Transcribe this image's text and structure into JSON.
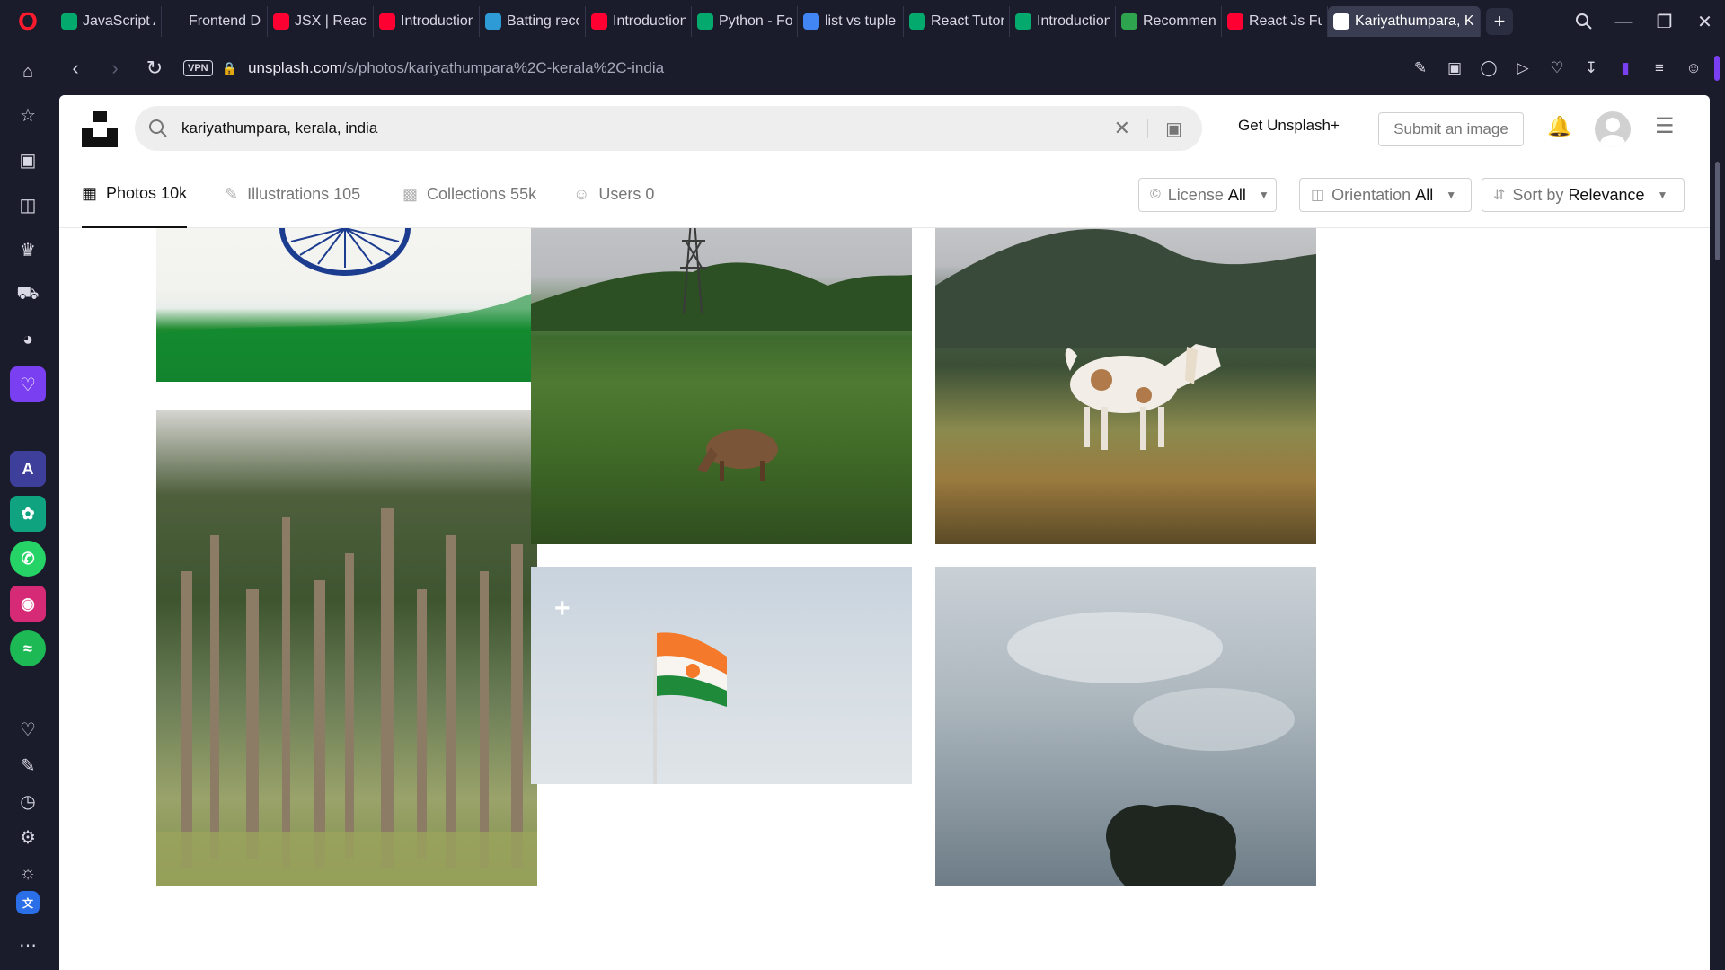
{
  "browser": {
    "tabs": [
      {
        "title": "JavaScript A",
        "favicon": "w3schools-icon",
        "color": "#04aa6d"
      },
      {
        "title": "Frontend De",
        "favicon": "freecodecamp-icon",
        "color": "#1b1c2b"
      },
      {
        "title": "JSX | React J",
        "favicon": "youtube-icon",
        "color": "#ff0033"
      },
      {
        "title": "Introduction",
        "favicon": "youtube-icon",
        "color": "#ff0033"
      },
      {
        "title": "Batting reco",
        "favicon": "globe-icon",
        "color": "#2e9bd6"
      },
      {
        "title": "Introduction",
        "favicon": "youtube-icon",
        "color": "#ff0033"
      },
      {
        "title": "Python - For",
        "favicon": "w3schools-icon",
        "color": "#04aa6d"
      },
      {
        "title": "list vs tuple",
        "favicon": "google-icon",
        "color": "#4285f4"
      },
      {
        "title": "React Tutori",
        "favicon": "w3schools-icon",
        "color": "#04aa6d"
      },
      {
        "title": "Introduction",
        "favicon": "w3schools-icon",
        "color": "#04aa6d"
      },
      {
        "title": "Recommenc",
        "favicon": "site-icon",
        "color": "#2ea44f"
      },
      {
        "title": "React Js Full",
        "favicon": "youtube-icon",
        "color": "#ff0033"
      },
      {
        "title": "Kariyathumpara, Kera",
        "favicon": "unsplash-icon",
        "color": "#ffffff"
      }
    ],
    "url_host": "unsplash.com",
    "url_path": "/s/photos/kariyathumpara%2C-kerala%2C-india",
    "vpn_label": "VPN"
  },
  "header": {
    "search_value": "kariyathumpara, kerala, india",
    "get_plus": "Get Unsplash+",
    "submit": "Submit an image"
  },
  "subnav": {
    "tabs": [
      {
        "label": "Photos 10k",
        "icon": "photo-icon"
      },
      {
        "label": "Illustrations 105",
        "icon": "pen-icon"
      },
      {
        "label": "Collections 55k",
        "icon": "collection-icon"
      },
      {
        "label": "Users 0",
        "icon": "users-icon"
      }
    ],
    "filters": {
      "license": {
        "label": "License",
        "value": "All"
      },
      "orientation": {
        "label": "Orientation",
        "value": "All"
      },
      "sort": {
        "label": "Sort by",
        "value": "Relevance"
      }
    }
  },
  "colors": {
    "accent_sidebar": "#7b3ff2",
    "opera_red": "#ff1b2d"
  }
}
